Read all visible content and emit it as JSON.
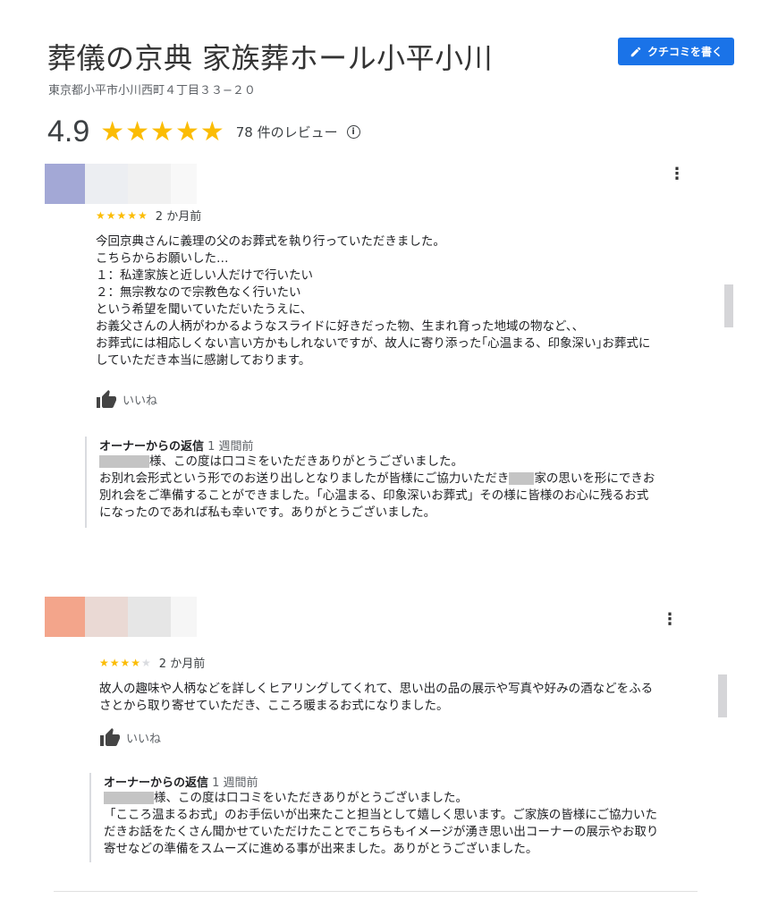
{
  "header": {
    "title": "葬儀の京典 家族葬ホール小平小川",
    "address": "東京都小平市小川西町４丁目３３−２０",
    "write_review_label": "クチコミを書く"
  },
  "summary": {
    "rating": "4.9",
    "stars": "★★★★★",
    "review_count": "78 件のレビュー",
    "info_icon": "i"
  },
  "reviews": [
    {
      "stars_on": "★★★★★",
      "stars_off": "",
      "rating_value": 5,
      "time": "2 か月前",
      "text": "今回京典さんに義理の父のお葬式を執り行っていただきました。\nこちらからお願いした…\n１：私達家族と近しい人だけで行いたい\n２：無宗教なので宗教色なく行いたい\nという希望を聞いていただいたうえに、\nお義父さんの人柄がわかるようなスライドに好きだった物、生まれ育った地域の物など、、\nお葬式には相応しくない言い方かもしれないですが、故人に寄り添った｢心温まる、印象深い｣お葬式に\nしていただき本当に感謝しております。",
      "like_label": "いいね",
      "owner_label": "オーナーからの返信",
      "owner_time": "1 週間前",
      "owner_line1": "様、この度は口コミをいただきありがとうございました。",
      "owner_line2a": "お別れ会形式という形でのお送り出しとなりましたが皆様にご協力いただき",
      "owner_line2b": "家の思いを形にできお",
      "owner_rest": "別れ会をご準備することができました。「心温まる、印象深いお葬式」その様に皆様のお心に残るお式\nになったのであれば私も幸いです。ありがとうございました。"
    },
    {
      "stars_on": "★★★★",
      "stars_off": "★",
      "rating_value": 4,
      "time": "2 か月前",
      "text": "故人の趣味や人柄などを詳しくヒアリングしてくれて、思い出の品の展示や写真や好みの酒などをふる\nさとから取り寄せていただき、こころ暖まるお式になりました。",
      "like_label": "いいね",
      "owner_label": "オーナーからの返信",
      "owner_time": "1 週間前",
      "owner_line1": "様、この度は口コミをいただきありがとうございました。",
      "owner_rest": "「こころ温まるお式」のお手伝いが出来たこと担当として嬉しく思います。ご家族の皆様にご協力いた\nだきお話をたくさん聞かせていただけたことでこちらもイメージが湧き思い出コーナーの展示やお取り\n寄せなどの準備をスムーズに進める事が出来ました。ありがとうございました。"
    }
  ],
  "icons": {
    "more": "⋮",
    "pencil": "pencil-icon",
    "thumb": "thumbs-up-icon"
  },
  "colors": {
    "accent": "#1a73e8",
    "star": "#fbbc04",
    "avatar1": "#a3a8d6",
    "avatar2": "#f3a58b"
  }
}
